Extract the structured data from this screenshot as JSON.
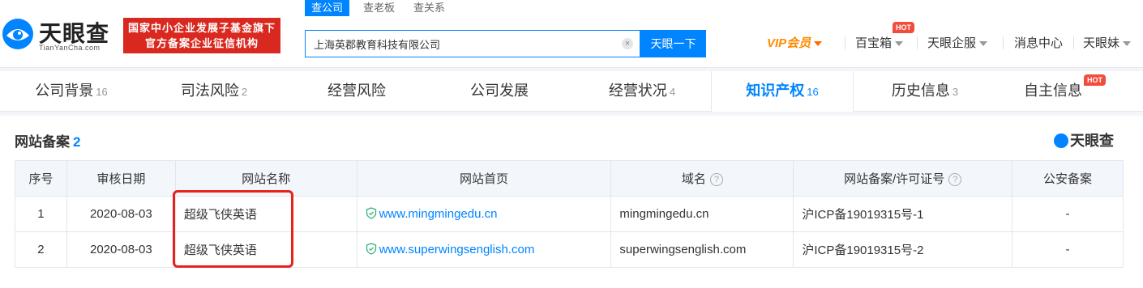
{
  "brand": {
    "name": "天眼查",
    "domain_text": "TianYanCha.com",
    "badge_line1": "国家中小企业发展子基金旗下",
    "badge_line2": "官方备案企业征信机构"
  },
  "search": {
    "tabs": [
      "查公司",
      "查老板",
      "查关系"
    ],
    "value": "上海英郡教育科技有限公司",
    "clear_icon": "×",
    "button_label": "天眼一下"
  },
  "nav": {
    "vip": "VIP会员",
    "toolbox": "百宝箱",
    "toolbox_hot": "HOT",
    "enterprise": "天眼企服",
    "messages": "消息中心",
    "user": "天眼妹"
  },
  "tabs": [
    {
      "label": "公司背景",
      "count": "16"
    },
    {
      "label": "司法风险",
      "count": "2"
    },
    {
      "label": "经营风险",
      "count": ""
    },
    {
      "label": "公司发展",
      "count": ""
    },
    {
      "label": "经营状况",
      "count": "4"
    },
    {
      "label": "知识产权",
      "count": "16"
    },
    {
      "label": "历史信息",
      "count": "3"
    },
    {
      "label": "自主信息",
      "count": "",
      "hot": "HOT"
    }
  ],
  "section": {
    "title": "网站备案",
    "count": "2",
    "watermark": "天眼查"
  },
  "table": {
    "headers": [
      "序号",
      "审核日期",
      "网站名称",
      "网站首页",
      "域名",
      "网站备案/许可证号",
      "公安备案"
    ],
    "rows": [
      {
        "no": "1",
        "date": "2020-08-03",
        "name": "超级飞侠英语",
        "homepage": "www.mingmingedu.cn",
        "domain": "mingmingedu.cn",
        "icp": "沪ICP备19019315号-1",
        "police": "-"
      },
      {
        "no": "2",
        "date": "2020-08-03",
        "name": "超级飞侠英语",
        "homepage": "www.superwingsenglish.com",
        "domain": "superwingsenglish.com",
        "icp": "沪ICP备19019315号-2",
        "police": "-"
      }
    ]
  },
  "colors": {
    "accent": "#0084ff",
    "brand_red": "#d9281f",
    "vip": "#ff8a00",
    "highlight_box": "#e8211a"
  }
}
